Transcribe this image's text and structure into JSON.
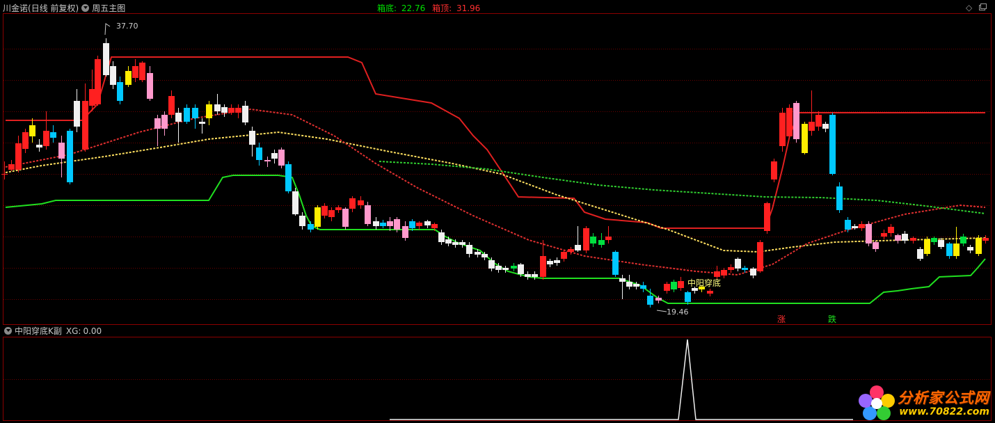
{
  "main_panel": {
    "stock_name": "川金诺",
    "period_mode": "(日线 前复权)",
    "indicator_name": "周五主图",
    "box_bottom_label": "箱底:",
    "box_bottom_value": "22.76",
    "box_top_label": "箱顶:",
    "box_top_value": "31.96",
    "high_marker": "37.70",
    "low_marker": "19.46",
    "signal_label": "中阳穿底",
    "rise_marker": "涨",
    "fall_marker": "跌"
  },
  "sub_panel": {
    "indicator_name": "中阳穿底K副",
    "xg_label": "XG:",
    "xg_value": "0.00"
  },
  "watermark": {
    "title": "分析家公式网",
    "url": "www.70822.com"
  },
  "controls": {
    "diamond_icon": "diamond-icon",
    "window_icon": "restore-window-icon"
  },
  "colors": {
    "background": "#000000",
    "frame_red": "#8b0000",
    "up_candle": "#ff2020",
    "down_candle": "#00c8ff",
    "box_top_line": "#e02020",
    "box_bottom_line": "#20e020",
    "box_label_green": "#00e000",
    "box_label_red": "#ff3030"
  }
}
